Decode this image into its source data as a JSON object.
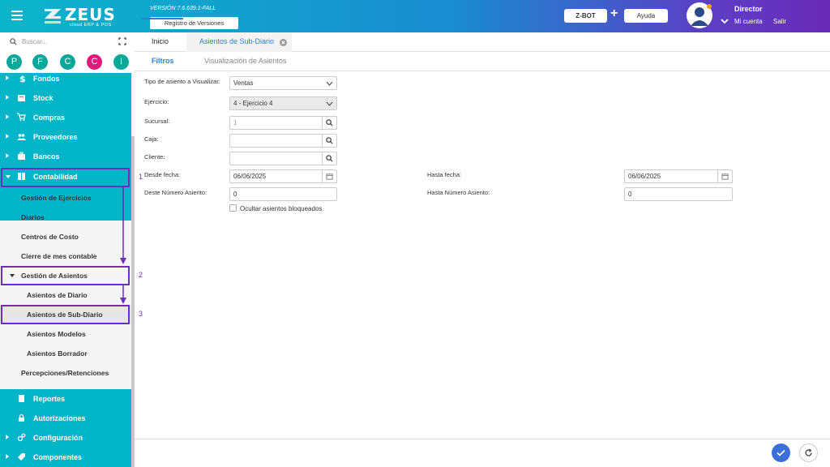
{
  "header": {
    "brand": "ZEUS",
    "brand_sub": "cloud ERP & POS",
    "version": "VERSIÓN 7.6.639.1-FALL",
    "registro_label": "Registro de Versiones",
    "zbot_label": "Z-BOT",
    "plus": "+",
    "ayuda_label": "Ayuda",
    "user_name": "Director",
    "mi_cuenta": "Mi cuenta",
    "salir": "Salir"
  },
  "sidebar": {
    "search_placeholder": "Buscar...",
    "circles": [
      {
        "letter": "P",
        "color": "#0aa89a"
      },
      {
        "letter": "F",
        "color": "#0aa89a"
      },
      {
        "letter": "C",
        "color": "#0aa89a"
      },
      {
        "letter": "C",
        "color": "#e0187a"
      },
      {
        "letter": "I",
        "color": "#0aa89a"
      }
    ],
    "top_items": [
      {
        "label": "Fondos",
        "icon": "dollar-icon"
      },
      {
        "label": "Stock",
        "icon": "box-icon"
      },
      {
        "label": "Compras",
        "icon": "cart-icon"
      },
      {
        "label": "Proveedores",
        "icon": "people-icon"
      },
      {
        "label": "Bancos",
        "icon": "briefcase-icon"
      },
      {
        "label": "Contabilidad",
        "icon": "book-icon"
      }
    ],
    "sub_items": [
      "Gestión de Ejercicios",
      "Diarios",
      "Centros de Costo",
      "Cierre de mes contable",
      "Gestión de Asientos"
    ],
    "subsub_items": [
      "Asientos de Diario",
      "Asientos de Sub-Diario",
      "Asientos Modelos",
      "Asientos Borrador"
    ],
    "sub_item_last": "Percepciones/Retenciones",
    "bottom_items": [
      {
        "label": "Reportes",
        "icon": "report-icon"
      },
      {
        "label": "Autorizaciones",
        "icon": "lock-icon"
      },
      {
        "label": "Configuración",
        "icon": "gears-icon"
      },
      {
        "label": "Componentes",
        "icon": "tag-icon"
      }
    ]
  },
  "annotations": [
    "1",
    "2",
    "3"
  ],
  "tabs": {
    "inicio": "Inicio",
    "active": "Asientos de Sub-Diario"
  },
  "subtabs": {
    "filtros": "Filtros",
    "visualizacion": "Visualización de Asientos"
  },
  "form": {
    "tipo_label": "Tipo de asiento a Visualizar:",
    "tipo_value": "Ventas",
    "ejercicio_label": "Ejercicio:",
    "ejercicio_value": "4 - Ejercicio 4",
    "sucursal_label": "Sucursal:",
    "sucursal_value": "1",
    "caja_label": "Caja:",
    "caja_value": "",
    "cliente_label": "Cliente:",
    "cliente_value": "",
    "desde_fecha_label": "Desde fecha:",
    "desde_fecha_value": "06/06/2025",
    "hasta_fecha_label": "Hasta fecha:",
    "hasta_fecha_value": "06/06/2025",
    "desde_num_label": "Deste Número Asiento:",
    "desde_num_value": "0",
    "hasta_num_label": "Hasta Número Asiento:",
    "hasta_num_value": "0",
    "ocultar_label": "Ocultar asientos bloqueados"
  },
  "colors": {
    "teal": "#00b5c8",
    "purple_annotation": "#6b2fb8",
    "active_blue": "#2b7fd4"
  }
}
